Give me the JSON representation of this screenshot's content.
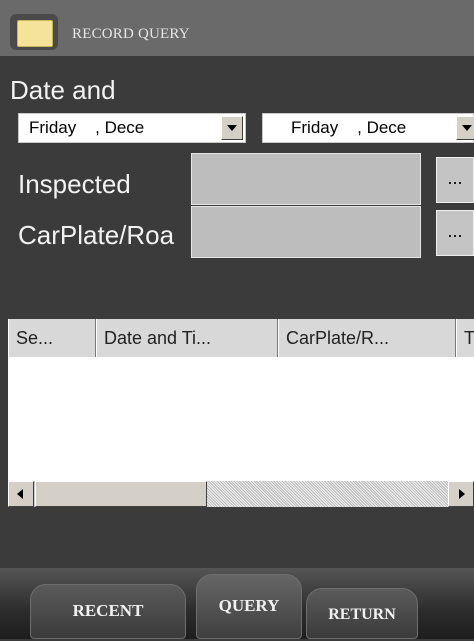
{
  "window": {
    "title": "RECORD QUERY"
  },
  "form": {
    "date_label": "Date and",
    "date_from": "Friday    , Dece",
    "date_to": "Friday    , Dece",
    "inspected_label": "Inspected",
    "inspected_button": "...",
    "carplate_label": "CarPlate/Roa",
    "carplate_button": "..."
  },
  "grid": {
    "columns": [
      "Se...",
      "Date and Ti...",
      "CarPlate/R...",
      "T"
    ]
  },
  "tabs": {
    "recent": "RECENT",
    "query": "QUERY",
    "return": "RETURN"
  },
  "icons": {
    "title_icon": "notepad-icon",
    "dropdown_icon": "chevron-down-icon"
  }
}
